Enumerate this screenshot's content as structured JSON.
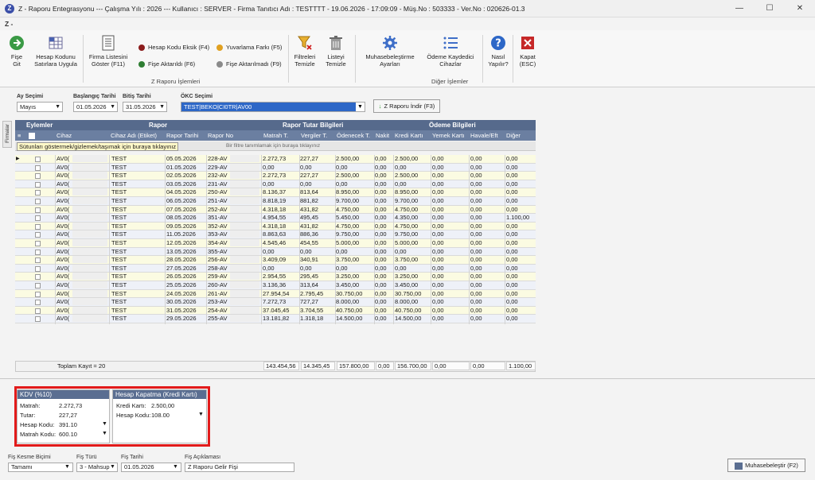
{
  "window": {
    "title": "Z - Raporu Entegrasyonu  ---  Çalışma Yılı : 2026  ---  Kullanıcı : SERVER - Firma Tanıtıcı Adı : TESTTTT - 19.06.2026 - 17:09:09 - Müş.No : 503333 - Ver.No : 020626-01.3",
    "app_icon_letter": "Z"
  },
  "ribbon": {
    "tab": "Z -",
    "buttons": {
      "fise_git": "Fişe\nGit",
      "hesap_kodunu": "Hesap Kodunu\nSatırlara Uygula",
      "firma_listesi": "Firma Listesini\nGöster (F11)",
      "filtreleri": "Filtreleri\nTemizle",
      "listeyi": "Listeyi\nTemizle",
      "muhasebe_ayar": "Muhasebeleştirme\nAyarları",
      "odeme": "Ödeme Kaydedici\nCihazlar",
      "nasil": "Nasıl\nYapılır?",
      "kapat": "Kapat\n(ESC)"
    },
    "legend": {
      "hesap_kodu_eksik": "Hesap Kodu Eksik (F4)",
      "fise_aktarildi": "Fişe Aktarıldı (F6)",
      "yuvarlama": "Yuvarlama Farkı (F5)",
      "fise_aktarilmadi": "Fişe Aktarılmadı (F9)"
    },
    "groups": {
      "z_raporu": "Z Raporu İşlemleri",
      "diger": "Diğer İşlemler"
    },
    "colors": {
      "red": "#8b1c1c",
      "green": "#2e7d32",
      "orange": "#e0a020",
      "gray": "#8a8a8a"
    }
  },
  "filters": {
    "ay_label": "Ay Seçimi",
    "ay_value": "Mayıs",
    "bas_label": "Başlangıç Tarihi",
    "bas_value": "01.05.2026",
    "bit_label": "Bitiş Tarihi",
    "bit_value": "31.05.2026",
    "okc_label": "ÖKC Seçimi",
    "okc_value": "TEST|BEKO|CI0TR|AV00",
    "download_btn": "Z Raporu İndir (F3)"
  },
  "sidetab": "Firmalar",
  "grid": {
    "groups": {
      "eylemler": "Eylemler",
      "rapor": "Rapor",
      "tutar": "Rapor Tutar Bilgileri",
      "odeme": "Ödeme Bilgileri"
    },
    "columns": [
      "Cihaz",
      "Cihaz Adı (Etiket)",
      "Rapor Tarihi",
      "Rapor No",
      "Matrah T.",
      "Vergiler T.",
      "Ödenecek T.",
      "Nakit",
      "Kredi Kartı",
      "Yemek Kartı",
      "Havale/Eft",
      "Diğer"
    ],
    "hint_drag": "Sütunları göstermek/gizlemek/taşımak için buraya tıklayınız",
    "hint_filter": "Bir filtre tanımlamak için buraya tıklayınız",
    "rows": [
      {
        "cihaz": "AV0(",
        "ad": "TEST",
        "tarih": "05.05.2026",
        "no": "228-AV",
        "matrah": "2.272,73",
        "vergi": "227,27",
        "odenecek": "2.500,00",
        "nakit": "0,00",
        "kredi": "2.500,00",
        "yemek": "0,00",
        "havale": "0,00",
        "diger": "0,00"
      },
      {
        "cihaz": "AV0(",
        "ad": "TEST",
        "tarih": "01.05.2026",
        "no": "229-AV",
        "matrah": "0,00",
        "vergi": "0,00",
        "odenecek": "0,00",
        "nakit": "0,00",
        "kredi": "0,00",
        "yemek": "0,00",
        "havale": "0,00",
        "diger": "0,00"
      },
      {
        "cihaz": "AV0(",
        "ad": "TEST",
        "tarih": "02.05.2026",
        "no": "232-AV",
        "matrah": "2.272,73",
        "vergi": "227,27",
        "odenecek": "2.500,00",
        "nakit": "0,00",
        "kredi": "2.500,00",
        "yemek": "0,00",
        "havale": "0,00",
        "diger": "0,00"
      },
      {
        "cihaz": "AV0(",
        "ad": "TEST",
        "tarih": "03.05.2026",
        "no": "231-AV",
        "matrah": "0,00",
        "vergi": "0,00",
        "odenecek": "0,00",
        "nakit": "0,00",
        "kredi": "0,00",
        "yemek": "0,00",
        "havale": "0,00",
        "diger": "0,00"
      },
      {
        "cihaz": "AV0(",
        "ad": "TEST",
        "tarih": "04.05.2026",
        "no": "250-AV",
        "matrah": "8.136,37",
        "vergi": "813,64",
        "odenecek": "8.950,00",
        "nakit": "0,00",
        "kredi": "8.950,00",
        "yemek": "0,00",
        "havale": "0,00",
        "diger": "0,00"
      },
      {
        "cihaz": "AV0(",
        "ad": "TEST",
        "tarih": "06.05.2026",
        "no": "251-AV",
        "matrah": "8.818,19",
        "vergi": "881,82",
        "odenecek": "9.700,00",
        "nakit": "0,00",
        "kredi": "9.700,00",
        "yemek": "0,00",
        "havale": "0,00",
        "diger": "0,00"
      },
      {
        "cihaz": "AV0(",
        "ad": "TEST",
        "tarih": "07.05.2026",
        "no": "252-AV",
        "matrah": "4.318,18",
        "vergi": "431,82",
        "odenecek": "4.750,00",
        "nakit": "0,00",
        "kredi": "4.750,00",
        "yemek": "0,00",
        "havale": "0,00",
        "diger": "0,00"
      },
      {
        "cihaz": "AV0(",
        "ad": "TEST",
        "tarih": "08.05.2026",
        "no": "351-AV",
        "matrah": "4.954,55",
        "vergi": "495,45",
        "odenecek": "5.450,00",
        "nakit": "0,00",
        "kredi": "4.350,00",
        "yemek": "0,00",
        "havale": "0,00",
        "diger": "1.100,00"
      },
      {
        "cihaz": "AV0(",
        "ad": "TEST",
        "tarih": "09.05.2026",
        "no": "352-AV",
        "matrah": "4.318,18",
        "vergi": "431,82",
        "odenecek": "4.750,00",
        "nakit": "0,00",
        "kredi": "4.750,00",
        "yemek": "0,00",
        "havale": "0,00",
        "diger": "0,00"
      },
      {
        "cihaz": "AV0(",
        "ad": "TEST",
        "tarih": "11.05.2026",
        "no": "353-AV",
        "matrah": "8.863,63",
        "vergi": "886,36",
        "odenecek": "9.750,00",
        "nakit": "0,00",
        "kredi": "9.750,00",
        "yemek": "0,00",
        "havale": "0,00",
        "diger": "0,00"
      },
      {
        "cihaz": "AV0(",
        "ad": "TEST",
        "tarih": "12.05.2026",
        "no": "354-AV",
        "matrah": "4.545,46",
        "vergi": "454,55",
        "odenecek": "5.000,00",
        "nakit": "0,00",
        "kredi": "5.000,00",
        "yemek": "0,00",
        "havale": "0,00",
        "diger": "0,00"
      },
      {
        "cihaz": "AV0(",
        "ad": "TEST",
        "tarih": "13.05.2026",
        "no": "355-AV",
        "matrah": "0,00",
        "vergi": "0,00",
        "odenecek": "0,00",
        "nakit": "0,00",
        "kredi": "0,00",
        "yemek": "0,00",
        "havale": "0,00",
        "diger": "0,00"
      },
      {
        "cihaz": "AV0(",
        "ad": "TEST",
        "tarih": "28.05.2026",
        "no": "256-AV",
        "matrah": "3.409,09",
        "vergi": "340,91",
        "odenecek": "3.750,00",
        "nakit": "0,00",
        "kredi": "3.750,00",
        "yemek": "0,00",
        "havale": "0,00",
        "diger": "0,00"
      },
      {
        "cihaz": "AV0(",
        "ad": "TEST",
        "tarih": "27.05.2026",
        "no": "258-AV",
        "matrah": "0,00",
        "vergi": "0,00",
        "odenecek": "0,00",
        "nakit": "0,00",
        "kredi": "0,00",
        "yemek": "0,00",
        "havale": "0,00",
        "diger": "0,00"
      },
      {
        "cihaz": "AV0(",
        "ad": "TEST",
        "tarih": "26.05.2026",
        "no": "259-AV",
        "matrah": "2.954,55",
        "vergi": "295,45",
        "odenecek": "3.250,00",
        "nakit": "0,00",
        "kredi": "3.250,00",
        "yemek": "0,00",
        "havale": "0,00",
        "diger": "0,00"
      },
      {
        "cihaz": "AV0(",
        "ad": "TEST",
        "tarih": "25.05.2026",
        "no": "260-AV",
        "matrah": "3.136,36",
        "vergi": "313,64",
        "odenecek": "3.450,00",
        "nakit": "0,00",
        "kredi": "3.450,00",
        "yemek": "0,00",
        "havale": "0,00",
        "diger": "0,00"
      },
      {
        "cihaz": "AV0(",
        "ad": "TEST",
        "tarih": "24.05.2026",
        "no": "261-AV",
        "matrah": "27.954,54",
        "vergi": "2.795,45",
        "odenecek": "30.750,00",
        "nakit": "0,00",
        "kredi": "30.750,00",
        "yemek": "0,00",
        "havale": "0,00",
        "diger": "0,00"
      },
      {
        "cihaz": "AV0(",
        "ad": "TEST",
        "tarih": "30.05.2026",
        "no": "253-AV",
        "matrah": "7.272,73",
        "vergi": "727,27",
        "odenecek": "8.000,00",
        "nakit": "0,00",
        "kredi": "8.000,00",
        "yemek": "0,00",
        "havale": "0,00",
        "diger": "0,00"
      },
      {
        "cihaz": "AV0(",
        "ad": "TEST",
        "tarih": "31.05.2026",
        "no": "254-AV",
        "matrah": "37.045,45",
        "vergi": "3.704,55",
        "odenecek": "40.750,00",
        "nakit": "0,00",
        "kredi": "40.750,00",
        "yemek": "0,00",
        "havale": "0,00",
        "diger": "0,00"
      },
      {
        "cihaz": "AV0(",
        "ad": "TEST",
        "tarih": "29.05.2026",
        "no": "255-AV",
        "matrah": "13.181,82",
        "vergi": "1.318,18",
        "odenecek": "14.500,00",
        "nakit": "0,00",
        "kredi": "14.500,00",
        "yemek": "0,00",
        "havale": "0,00",
        "diger": "0,00"
      }
    ],
    "totals": {
      "label": "Toplam Kayıt = 20",
      "matrah": "143.454,56",
      "vergi": "14.345,45",
      "odenecek": "157.800,00",
      "nakit": "0,00",
      "kredi": "156.700,00",
      "yemek": "0,00",
      "havale": "0,00",
      "diger": "1.100,00"
    }
  },
  "kdv": {
    "title": "KDV (%10)",
    "matrah_label": "Matrah:",
    "matrah": "2.272,73",
    "tutar_label": "Tutar:",
    "tutar": "227,27",
    "hesap_label": "Hesap Kodu:",
    "hesap": "391.10",
    "matrah_kodu_label": "Matrah Kodu:",
    "matrah_kodu": "600.10"
  },
  "hesap_kapatma": {
    "title": "Hesap Kapatma (Kredi Kartı)",
    "kredi_label": "Kredi Kartı:",
    "kredi": "2.500,00",
    "hesap_label": "Hesap Kodu:",
    "hesap": "108.00"
  },
  "footer": {
    "kesme_label": "Fiş Kesme Biçimi",
    "kesme_value": "Tamamı",
    "turu_label": "Fiş Türü",
    "turu_value": "3 - Mahsup",
    "tarih_label": "Fiş Tarihi",
    "tarih_value": "01.05.2026",
    "aciklama_label": "Fiş Açıklaması",
    "aciklama_value": "Z Raporu Gelir Fişi",
    "muhasebe_btn": "Muhasebeleştir (F2)"
  }
}
